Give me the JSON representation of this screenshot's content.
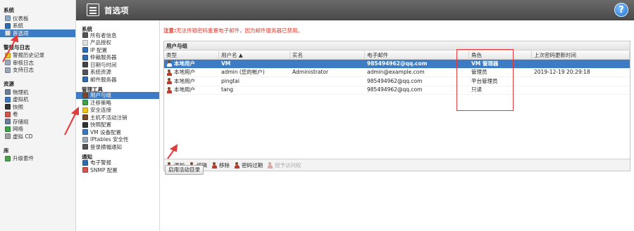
{
  "header": {
    "title": "首选项",
    "help": "?"
  },
  "leftnav": {
    "sections": [
      {
        "title": "系统",
        "items": [
          {
            "label": "仪表板",
            "icon": "dashboard-icon",
            "color": "#8ea8c9",
            "selected": false
          },
          {
            "label": "系统",
            "icon": "system-icon",
            "color": "#2f6db3",
            "selected": false
          },
          {
            "label": "首选项",
            "icon": "preferences-icon",
            "color": "#e0e0e0",
            "selected": true
          }
        ]
      },
      {
        "title": "警报与日志",
        "items": [
          {
            "label": "警报历史记录",
            "icon": "alert-history-icon",
            "color": "#f0c419",
            "selected": false
          },
          {
            "label": "审核日志",
            "icon": "audit-log-icon",
            "color": "#9aa8b8",
            "selected": false
          },
          {
            "label": "支持日志",
            "icon": "support-log-icon",
            "color": "#9aa8b8",
            "selected": false
          }
        ]
      },
      {
        "title": "资源",
        "items": [
          {
            "label": "物理机",
            "icon": "physical-machine-icon",
            "color": "#6b7f99",
            "selected": false
          },
          {
            "label": "虚拟机",
            "icon": "virtual-machine-icon",
            "color": "#3b78c2",
            "selected": false
          },
          {
            "label": "快照",
            "icon": "snapshot-icon",
            "color": "#333333",
            "selected": false
          },
          {
            "label": "卷",
            "icon": "volume-icon",
            "color": "#d6534a",
            "selected": false
          },
          {
            "label": "存储组",
            "icon": "storage-group-icon",
            "color": "#6b7f99",
            "selected": false
          },
          {
            "label": "网络",
            "icon": "network-icon",
            "color": "#3ca34a",
            "selected": false
          },
          {
            "label": "虚拟 CD",
            "icon": "virtual-cd-icon",
            "color": "#a0a0a0",
            "selected": false
          }
        ]
      },
      {
        "title": "库",
        "items": [
          {
            "label": "升级套件",
            "icon": "upgrade-kit-icon",
            "color": "#4aa34a",
            "selected": false
          }
        ]
      }
    ]
  },
  "subnav": {
    "sections": [
      {
        "title": "系统",
        "items": [
          {
            "label": "所有者信息",
            "icon": "owner-info-icon",
            "color": "#555555",
            "selected": false
          },
          {
            "label": "产品授权",
            "icon": "license-icon",
            "color": "#e0e0e0",
            "selected": false
          },
          {
            "label": "IP 配置",
            "icon": "ip-config-icon",
            "color": "#2f6db3",
            "selected": false
          },
          {
            "label": "仲裁服务器",
            "icon": "quorum-server-icon",
            "color": "#2f6db3",
            "selected": false
          },
          {
            "label": "日期与时间",
            "icon": "clock-icon",
            "color": "#444444",
            "selected": false
          },
          {
            "label": "系统资源",
            "icon": "system-resources-icon",
            "color": "#555555",
            "selected": false
          },
          {
            "label": "邮件服务器",
            "icon": "mail-server-icon",
            "color": "#2f6db3",
            "selected": false
          }
        ]
      },
      {
        "title": "管理工具",
        "items": [
          {
            "label": "用户与组",
            "icon": "users-groups-icon",
            "color": "#7a4b2a",
            "selected": true
          },
          {
            "label": "迁移策略",
            "icon": "migration-policy-icon",
            "color": "#3ca34a",
            "selected": false
          },
          {
            "label": "安全连接",
            "icon": "secure-connection-icon",
            "color": "#f0c419",
            "selected": false
          },
          {
            "label": "主机不活动注销",
            "icon": "inactivity-logout-icon",
            "color": "#7a4b2a",
            "selected": false
          },
          {
            "label": "快照配置",
            "icon": "snapshot-config-icon",
            "color": "#333333",
            "selected": false
          },
          {
            "label": "VM 设备配置",
            "icon": "vm-device-icon",
            "color": "#3b78c2",
            "selected": false
          },
          {
            "label": "IPtables 安全性",
            "icon": "iptables-icon",
            "color": "#9aa8b8",
            "selected": false
          },
          {
            "label": "登录横幅通知",
            "icon": "login-banner-icon",
            "color": "#555555",
            "selected": false
          }
        ]
      },
      {
        "title": "通知",
        "items": [
          {
            "label": "电子警报",
            "icon": "email-alert-icon",
            "color": "#2f6db3",
            "selected": false
          },
          {
            "label": "SNMP 配置",
            "icon": "snmp-config-icon",
            "color": "#d6534a",
            "selected": false
          }
        ]
      }
    ]
  },
  "warning": {
    "prefix": "注意:",
    "text": "无法传输密码重置电子邮件，因为邮件服务器已禁用。"
  },
  "panel": {
    "title": "用户与组",
    "columns": [
      "类型",
      "用户名 ▲",
      "实名",
      "电子邮件",
      "角色",
      "上次密码更新时间"
    ],
    "rows": [
      {
        "type": "本地用户",
        "username": "VM",
        "realname": "",
        "email": "985494962@qq.com",
        "role": "VM 管理器",
        "updated": "",
        "selected": true
      },
      {
        "type": "本地用户",
        "username": "admin (您的帐户)",
        "realname": "Administrator",
        "email": "admin@example.com",
        "role": "管理员",
        "updated": "2019-12-19 20:29:18",
        "selected": false
      },
      {
        "type": "本地用户",
        "username": "pingtai",
        "realname": "",
        "email": "985494962@qq.com",
        "role": "平台管理员",
        "updated": "",
        "selected": false
      },
      {
        "type": "本地用户",
        "username": "tang",
        "realname": "",
        "email": "985494962@qq.com",
        "role": "只读",
        "updated": "",
        "selected": false
      }
    ],
    "toolbar": [
      {
        "label": "添加",
        "icon": "add-user-icon",
        "disabled": false
      },
      {
        "label": "编辑",
        "icon": "edit-user-icon",
        "disabled": false
      },
      {
        "label": "移除",
        "icon": "remove-user-icon",
        "disabled": false
      },
      {
        "label": "密码过期",
        "icon": "password-expire-icon",
        "disabled": false
      },
      {
        "label": "授予访问权",
        "icon": "grant-access-icon",
        "disabled": true
      }
    ]
  },
  "enable_ad_button": "启用活动目录",
  "colors": {
    "accent": "#3d7cc4",
    "header": "#555555",
    "warning": "#e03c2f",
    "annotation": "#e33b3b"
  }
}
